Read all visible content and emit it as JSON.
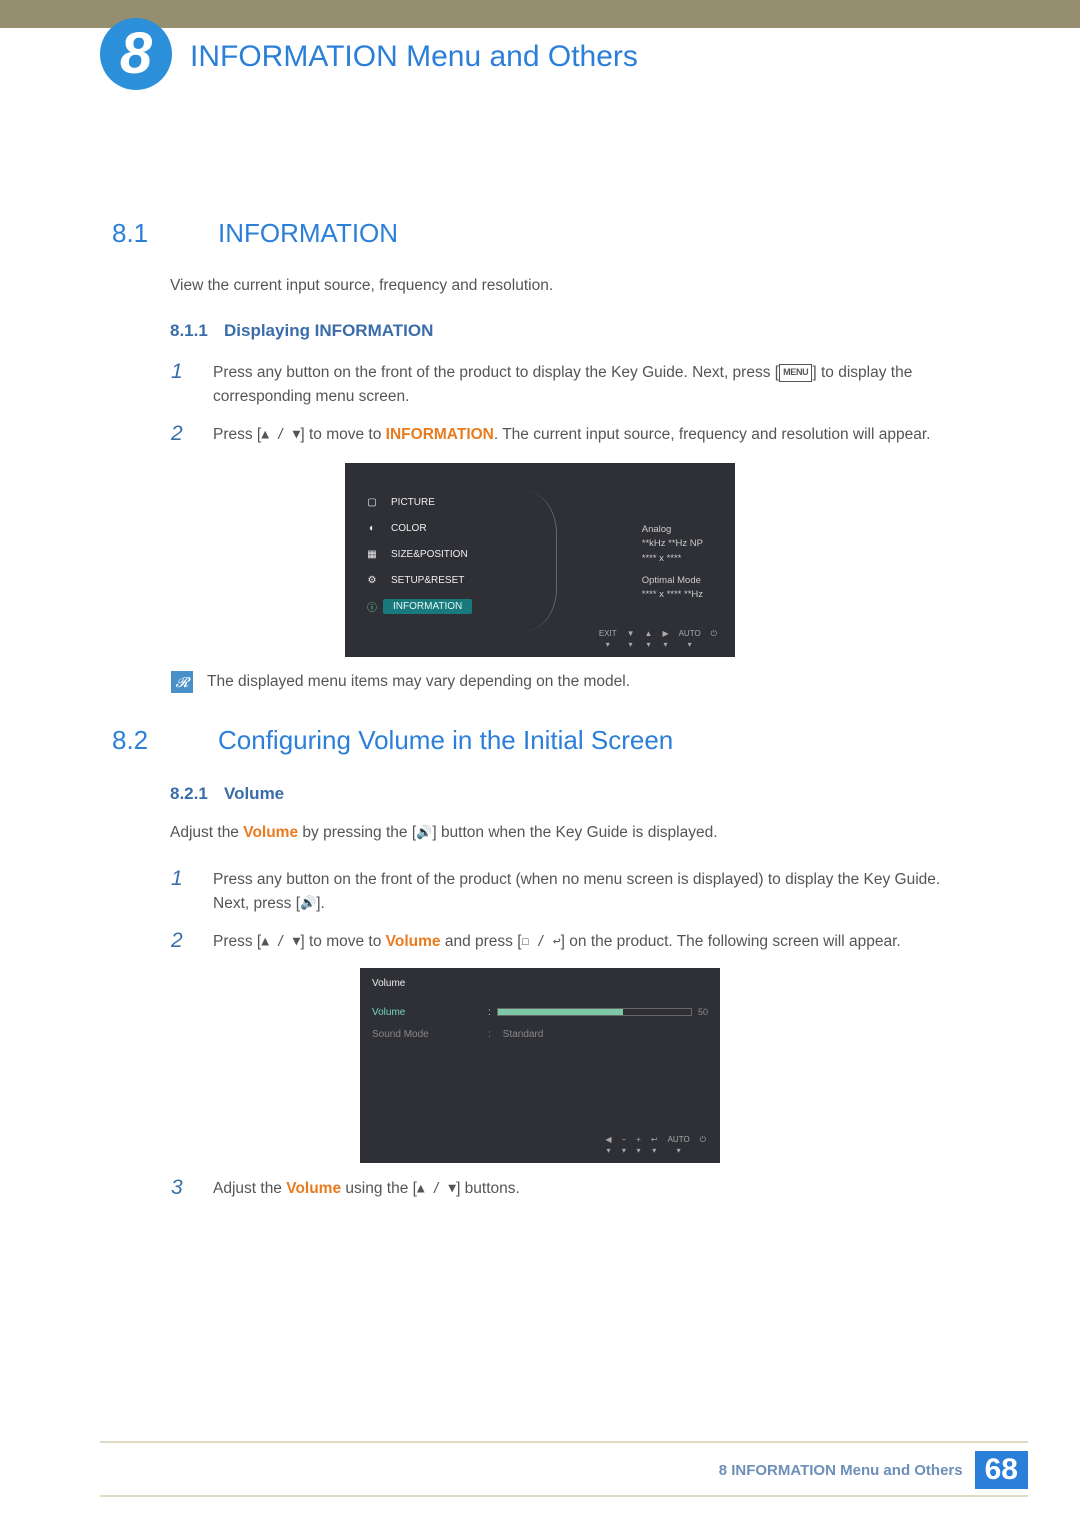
{
  "chapter": {
    "number": "8",
    "title": "INFORMATION Menu and Others"
  },
  "s81": {
    "num": "8.1",
    "title": "INFORMATION",
    "intro": "View the current input source, frequency and resolution.",
    "s811": {
      "num": "8.1.1",
      "title": "Displaying INFORMATION",
      "steps": {
        "1": {
          "n": "1",
          "pre": "Press any button on the front of the product to display the Key Guide. Next, press [",
          "menu": "MENU",
          "post": "] to display the corresponding menu screen."
        },
        "2": {
          "n": "2",
          "pre": "Press [",
          "icons": "▲ / ▼",
          "mid": "] to move to ",
          "kw": "INFORMATION",
          "post": ". The current input source, frequency and resolution will appear."
        }
      },
      "osd": {
        "items": {
          "picture": "PICTURE",
          "color": "COLOR",
          "size": "SIZE&POSITION",
          "setup": "SETUP&RESET",
          "info": "INFORMATION"
        },
        "right": {
          "l1": "Analog",
          "l2": "**kHz **Hz NP",
          "l3": "**** x ****",
          "l4": "Optimal Mode",
          "l5": "**** x **** **Hz"
        },
        "nav": {
          "exit": "EXIT",
          "auto": "AUTO"
        }
      },
      "note": "The displayed menu items may vary depending on the model."
    }
  },
  "s82": {
    "num": "8.2",
    "title": "Configuring Volume in the Initial Screen",
    "s821": {
      "num": "8.2.1",
      "title": "Volume",
      "intro": {
        "pre": "Adjust the ",
        "kw": "Volume",
        "mid": " by pressing the [",
        "icon": "🔊",
        "post": "] button when the Key Guide is displayed."
      },
      "steps": {
        "1": {
          "n": "1",
          "pre": "Press any button on the front of the product (when no menu screen is displayed) to display the Key Guide. Next, press [",
          "icon": "🔊",
          "post": "]."
        },
        "2": {
          "n": "2",
          "pre": "Press [",
          "ic1": "▲ / ▼",
          "mid1": "] to move to ",
          "kw": "Volume",
          "mid2": " and press [",
          "ic2": "☐ / ↩",
          "post": "] on the product. The following screen will appear."
        },
        "3": {
          "n": "3",
          "pre": "Adjust the ",
          "kw": "Volume",
          "mid": " using the [",
          "ic": "▲ / ▼",
          "post": "] buttons."
        }
      },
      "osd": {
        "title": "Volume",
        "row_vol_label": "Volume",
        "row_vol_sep": ":",
        "row_vol_value": "50",
        "row_mode_label": "Sound Mode",
        "row_mode_sep": ":",
        "row_mode_value": "Standard",
        "nav": {
          "auto": "AUTO"
        }
      }
    }
  },
  "footer": {
    "label": "8 INFORMATION Menu and Others",
    "page": "68"
  }
}
